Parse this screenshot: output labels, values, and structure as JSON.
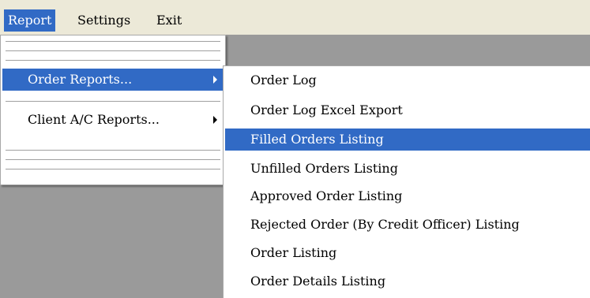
{
  "menubar": {
    "items": [
      {
        "label": "Report"
      },
      {
        "label": "Settings"
      },
      {
        "label": "Exit"
      }
    ]
  },
  "report_menu": {
    "items": [
      {
        "label": "Order Reports...",
        "has_submenu": true
      },
      {
        "label": "Client A/C Reports...",
        "has_submenu": true
      }
    ]
  },
  "order_reports_menu": {
    "items": [
      {
        "label": "Order Log"
      },
      {
        "label": "Order Log Excel Export"
      },
      {
        "label": "Filled Orders Listing"
      },
      {
        "label": "Unfilled Orders Listing"
      },
      {
        "label": "Approved Order Listing"
      },
      {
        "label": "Rejected Order (By Credit Officer) Listing"
      },
      {
        "label": "Order Listing"
      },
      {
        "label": "Order Details Listing"
      }
    ]
  },
  "colors": {
    "highlight": "#316ac5",
    "menubar_bg": "#ece9d8",
    "workspace_bg": "#9a9a9a"
  }
}
